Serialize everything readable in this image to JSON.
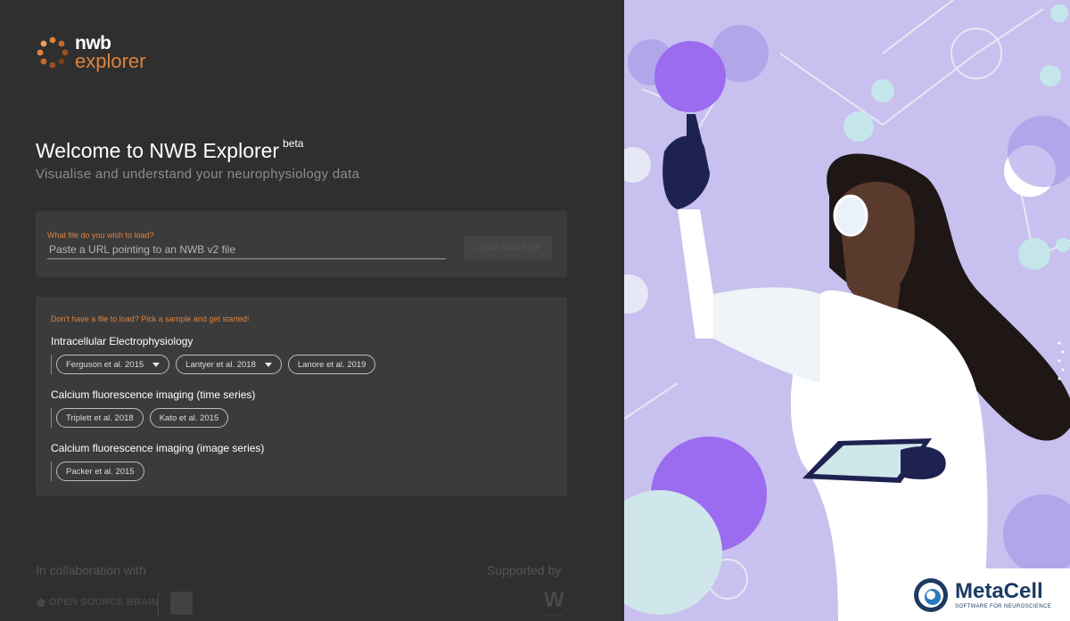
{
  "brand": {
    "nwb": "nwb",
    "explorer": "explorer",
    "accent_color": "#e0823c"
  },
  "header": {
    "title": "Welcome to NWB Explorer",
    "beta": "beta",
    "subtitle": "Visualise and understand your neurophysiology data"
  },
  "load_form": {
    "label": "What file do you wish to load?",
    "placeholder": "Paste a URL pointing to an NWB v2 file",
    "value": "",
    "button_label": "LOAD NWB FILE"
  },
  "samples": {
    "prompt": "Don't have a file to load? Pick a sample and get started!",
    "groups": [
      {
        "title": "Intracellular Electrophysiology",
        "chips": [
          {
            "label": "Ferguson et al. 2015",
            "dropdown": true
          },
          {
            "label": "Lantyer et al. 2018",
            "dropdown": true
          },
          {
            "label": "Lanore et al. 2019",
            "dropdown": false
          }
        ]
      },
      {
        "title": "Calcium fluorescence imaging (time series)",
        "chips": [
          {
            "label": "Triplett et al. 2018",
            "dropdown": false
          },
          {
            "label": "Kato et al. 2015",
            "dropdown": false
          }
        ]
      },
      {
        "title": "Calcium fluorescence imaging (image series)",
        "chips": [
          {
            "label": "Packer et al. 2015",
            "dropdown": false
          }
        ]
      }
    ]
  },
  "footer": {
    "collaboration": "In collaboration with",
    "supported": "Supported by",
    "osb_logo": "OPEN SOURCE BRAIN",
    "w_logo": "W",
    "w_sub": "wellcome"
  },
  "metacell": {
    "name": "MetaCell",
    "tagline": "SOFTWARE FOR NEUROSCIENCE"
  },
  "illustration": {
    "icon": "scientist-illustration",
    "background": "#c8c0ee"
  }
}
